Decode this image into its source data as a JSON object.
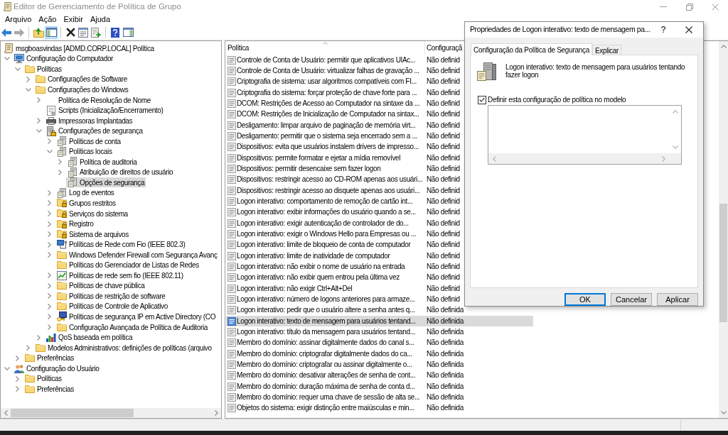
{
  "window": {
    "title": "Editor de Gerenciamento de Política de Grupo"
  },
  "menu": [
    "Arquivo",
    "Ação",
    "Exibir",
    "Ajuda"
  ],
  "toolbar": [
    [
      {
        "kind": "back",
        "disabled": false,
        "on": false
      },
      {
        "kind": "forward",
        "disabled": true,
        "on": false
      }
    ],
    [
      {
        "kind": "up",
        "disabled": false,
        "on": false
      },
      {
        "kind": "tree",
        "disabled": false,
        "on": true
      }
    ],
    [
      {
        "kind": "delete",
        "disabled": false,
        "on": false
      },
      {
        "kind": "properties",
        "disabled": false,
        "on": false
      },
      {
        "kind": "export",
        "disabled": false,
        "on": false
      }
    ],
    [
      {
        "kind": "help",
        "disabled": false,
        "on": false
      },
      {
        "kind": "pane",
        "disabled": false,
        "on": false
      }
    ]
  ],
  "tree": [
    {
      "label": "msgboasvindas [ADMD.CORP.LOCAL] Política",
      "kind": "gpo",
      "selected": false,
      "children": [
        {
          "label": "Configuração do Computador",
          "kind": "computer",
          "expanded": true,
          "selected": false,
          "children": [
            {
              "label": "Políticas",
              "kind": "folder",
              "expanded": true,
              "selected": false,
              "children": [
                {
                  "label": "Configurações de Software",
                  "kind": "folder",
                  "expanded": false,
                  "selected": false
                },
                {
                  "label": "Configurações do Windows",
                  "kind": "folder",
                  "expanded": true,
                  "selected": false,
                  "children": [
                    {
                      "label": "Política de Resolução de Nome",
                      "kind": "blank",
                      "expanded": false,
                      "selected": false
                    },
                    {
                      "label": "Scripts (Inicialização/Encerramento)",
                      "kind": "script",
                      "selected": false
                    },
                    {
                      "label": "Impressoras Implantadas",
                      "kind": "printer",
                      "expanded": false,
                      "selected": false
                    },
                    {
                      "label": "Configurações de segurança",
                      "kind": "security",
                      "expanded": true,
                      "selected": false,
                      "children": [
                        {
                          "label": "Políticas de conta",
                          "kind": "policy",
                          "expanded": false,
                          "selected": false
                        },
                        {
                          "label": "Políticas locais",
                          "kind": "policy",
                          "expanded": true,
                          "selected": false,
                          "children": [
                            {
                              "label": "Política de auditoria",
                              "kind": "policy",
                              "expanded": false,
                              "selected": false
                            },
                            {
                              "label": "Atribuição de direitos de usuário",
                              "kind": "policy",
                              "expanded": false,
                              "selected": false
                            },
                            {
                              "label": "Opções de segurança",
                              "kind": "policy",
                              "selected": true
                            }
                          ]
                        },
                        {
                          "label": "Log de eventos",
                          "kind": "policy",
                          "expanded": false,
                          "selected": false
                        },
                        {
                          "label": "Grupos restritos",
                          "kind": "lockfolder",
                          "expanded": false,
                          "selected": false
                        },
                        {
                          "label": "Serviços do sistema",
                          "kind": "lockfolder",
                          "expanded": false,
                          "selected": false
                        },
                        {
                          "label": "Registro",
                          "kind": "lockfolder",
                          "expanded": false,
                          "selected": false
                        },
                        {
                          "label": "Sistema de arquivos",
                          "kind": "lockfolder",
                          "expanded": false,
                          "selected": false
                        },
                        {
                          "label": "Políticas de Rede com Fio (IEEE 802.3)",
                          "kind": "wired",
                          "expanded": false,
                          "selected": false
                        },
                        {
                          "label": "Windows Defender Firewall com Segurança Avanç",
                          "kind": "folder",
                          "expanded": false,
                          "selected": false
                        },
                        {
                          "label": "Políticas do Gerenciador de Listas de Redes",
                          "kind": "folder",
                          "selected": false
                        },
                        {
                          "label": "Políticas de rede sem fio (IEEE 802.11)",
                          "kind": "wireless",
                          "expanded": false,
                          "selected": false
                        },
                        {
                          "label": "Políticas de chave pública",
                          "kind": "folder",
                          "expanded": false,
                          "selected": false
                        },
                        {
                          "label": "Políticas de restrição de software",
                          "kind": "folder",
                          "expanded": false,
                          "selected": false
                        },
                        {
                          "label": "Políticas de Controle de Aplicativo",
                          "kind": "folder",
                          "expanded": false,
                          "selected": false
                        },
                        {
                          "label": "Políticas de segurança IP em Active Directory (CO",
                          "kind": "ipsec",
                          "expanded": false,
                          "selected": false
                        },
                        {
                          "label": "Configuração Avançada de Política de Auditoria",
                          "kind": "folder",
                          "expanded": false,
                          "selected": false
                        }
                      ]
                    },
                    {
                      "label": "QoS baseada em política",
                      "kind": "qos",
                      "expanded": false,
                      "selected": false
                    }
                  ]
                },
                {
                  "label": "Modelos Administrativos: definições de políticas (arquivo",
                  "kind": "folder",
                  "expanded": false,
                  "selected": false
                }
              ]
            },
            {
              "label": "Preferências",
              "kind": "folder",
              "expanded": false,
              "selected": false
            }
          ]
        },
        {
          "label": "Configuração do Usuário",
          "kind": "users",
          "expanded": true,
          "selected": false,
          "children": [
            {
              "label": "Políticas",
              "kind": "folder",
              "expanded": false,
              "selected": false
            },
            {
              "label": "Preferências",
              "kind": "folder",
              "expanded": false,
              "selected": false
            }
          ]
        }
      ]
    }
  ],
  "list": {
    "columns": [
      {
        "label": "Política",
        "sorted": true
      },
      {
        "label": "Configuraçã",
        "sorted": false
      }
    ],
    "rows": [
      {
        "policy": "Controle de Conta de Usuário: permitir que aplicativos UIAc...",
        "setting": "Não definid",
        "selected": false
      },
      {
        "policy": "Controle de Conta de Usuário: virtualizar falhas de gravação ...",
        "setting": "Não definid",
        "selected": false
      },
      {
        "policy": "Criptografia de sistema: usar algoritmos compatíveis com FI...",
        "setting": "Não definid",
        "selected": false
      },
      {
        "policy": "Criptografia do sistema: forçar proteção de chave forte para ...",
        "setting": "Não definid",
        "selected": false
      },
      {
        "policy": "DCOM: Restrições de Acesso ao Computador na sintaxe da ...",
        "setting": "Não definid",
        "selected": false
      },
      {
        "policy": "DCOM: Restrições de Inicialização de Computador na sintax...",
        "setting": "Não definid",
        "selected": false
      },
      {
        "policy": "Desligamento: limpar arquivo de paginação de memória virt...",
        "setting": "Não definid",
        "selected": false
      },
      {
        "policy": "Desligamento: permitir que o sistema seja encerrado sem a ...",
        "setting": "Não definid",
        "selected": false
      },
      {
        "policy": "Dispositivos: evita que usuários instalem drivers de impresso...",
        "setting": "Não definid",
        "selected": false
      },
      {
        "policy": "Dispositivos: permite formatar e ejetar a mídia removível",
        "setting": "Não definid",
        "selected": false
      },
      {
        "policy": "Dispositivos: permitir desencaixe sem fazer logon",
        "setting": "Não definid",
        "selected": false
      },
      {
        "policy": "Dispositivos: restringir acesso ao CD-ROM apenas aos usuári...",
        "setting": "Não definid",
        "selected": false
      },
      {
        "policy": "Dispositivos: restringir acesso ao disquete apenas aos usuári...",
        "setting": "Não definid",
        "selected": false
      },
      {
        "policy": "Logon interativo: comportamento de remoção de cartão int...",
        "setting": "Não definid",
        "selected": false
      },
      {
        "policy": "Logon interativo: exibir informações do usuário quando a se...",
        "setting": "Não definid",
        "selected": false
      },
      {
        "policy": "Logon interativo: exigir autenticação de controlador de do...",
        "setting": "Não definid",
        "selected": false
      },
      {
        "policy": "Logon interativo: exigir o Windows Hello para Empresas ou ...",
        "setting": "Não definid",
        "selected": false
      },
      {
        "policy": "Logon interativo: limite de bloqueio de conta de computador",
        "setting": "Não definid",
        "selected": false
      },
      {
        "policy": "Logon interativo: limite de inatividade de computador",
        "setting": "Não definid",
        "selected": false
      },
      {
        "policy": "Logon interativo: não exibir o nome de usuário na entrada",
        "setting": "Não definid",
        "selected": false
      },
      {
        "policy": "Logon interativo: não exibir quem entrou pela última vez",
        "setting": "Não definid",
        "selected": false
      },
      {
        "policy": "Logon interativo: não exigir Ctrl+Alt+Del",
        "setting": "Não definid",
        "selected": false
      },
      {
        "policy": "Logon interativo: número de logons anteriores para armaze...",
        "setting": "Não definid",
        "selected": false
      },
      {
        "policy": "Logon interativo: pedir que o usuário altere a senha antes q...",
        "setting": "Não definida",
        "selected": false
      },
      {
        "policy": "Logon interativo: texto de mensagem para usuários tentand...",
        "setting": "Não definida",
        "selected": true
      },
      {
        "policy": "Logon interativo: título da mensagem para usuários tentand...",
        "setting": "Não definida",
        "selected": false
      },
      {
        "policy": "Membro do domínio: assinar digitalmente dados do canal s...",
        "setting": "Não definida",
        "selected": false
      },
      {
        "policy": "Membro do domínio: criptografar digitalmente dados do ca...",
        "setting": "Não definida",
        "selected": false
      },
      {
        "policy": "Membro do domínio: criptografar ou assinar digitalmente o...",
        "setting": "Não definida",
        "selected": false
      },
      {
        "policy": "Membro do domínio: desativar alterações de senha de cont...",
        "setting": "Não definida",
        "selected": false
      },
      {
        "policy": "Membro do domínio: duração máxima de senha de conta d...",
        "setting": "Não definida",
        "selected": false
      },
      {
        "policy": "Membro do domínio: requer uma chave de sessão de alta se...",
        "setting": "Não definida",
        "selected": false
      },
      {
        "policy": "Objetos do sistema: exigir distinção entre maiúsculas e min...",
        "setting": "Não definida",
        "selected": false
      }
    ]
  },
  "dialog": {
    "title": "Propriedades de Logon interativo: texto de mensagem pa...",
    "help": "?",
    "tabs": [
      {
        "label": "Configuração da Política de Segurança",
        "selected": true
      },
      {
        "label": "Explicar",
        "selected": false
      }
    ],
    "policy": "Logon interativo: texto de mensagem para usuários tentando fazer logon",
    "define_setting": {
      "label": "Definir esta configuração de política no modelo",
      "checked": true
    },
    "buttons": [
      {
        "label": "OK",
        "default": true
      },
      {
        "label": "Cancelar",
        "default": false
      },
      {
        "label": "Aplicar",
        "default": false
      }
    ]
  }
}
